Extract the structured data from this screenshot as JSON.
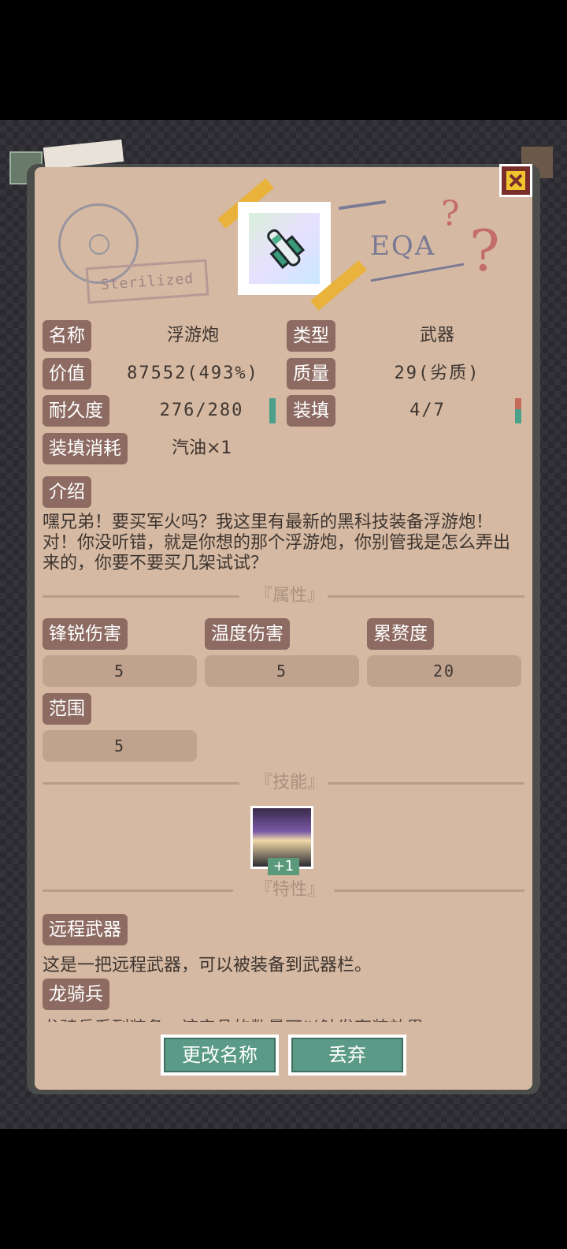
{
  "item": {
    "name_label": "名称",
    "name_value": "浮游炮",
    "type_label": "类型",
    "type_value": "武器",
    "value_label": "价值",
    "value_value": "87552(493%)",
    "quality_label": "质量",
    "quality_value": "29(劣质)",
    "durability_label": "耐久度",
    "durability_value": "276/280",
    "durability_fraction": 0.986,
    "reload_label": "装填",
    "reload_value": "4/7",
    "reload_fraction": 0.571,
    "reload_cost_label": "装填消耗",
    "reload_cost_value": "汽油×1",
    "intro_label": "介绍",
    "intro_text": "嘿兄弟！要买军火吗？我这里有最新的黑科技装备浮游炮！对！你没听错，就是你想的那个浮游炮，你别管我是怎么弄出来的，你要不要买几架试试？"
  },
  "decor": {
    "stamp_text": "Sterilized",
    "eoa_text": "EQA",
    "q1": "?",
    "q2": "?"
  },
  "attributes": {
    "title": "『属性』",
    "items": [
      {
        "label": "锋锐伤害",
        "value": "5"
      },
      {
        "label": "温度伤害",
        "value": "5"
      },
      {
        "label": "累赘度",
        "value": "20"
      },
      {
        "label": "范围",
        "value": "5"
      }
    ]
  },
  "skills": {
    "title": "『技能』",
    "badge": "+1",
    "icon": "skill-icon"
  },
  "traits": {
    "title": "『特性』",
    "items": [
      {
        "label": "远程武器",
        "text": "这是一把远程武器，可以被装备到武器栏。"
      },
      {
        "label": "龙骑兵",
        "text": "龙骑兵系列装备，该产品的数量可以触发套装效果"
      }
    ]
  },
  "buttons": {
    "rename": "更改名称",
    "discard": "丢弃"
  },
  "colors": {
    "paper": "#d5b9a2",
    "tag": "#8d6b62",
    "button": "#5a9a86",
    "close": "#7a2e2a",
    "accent_yellow": "#f1c530"
  }
}
